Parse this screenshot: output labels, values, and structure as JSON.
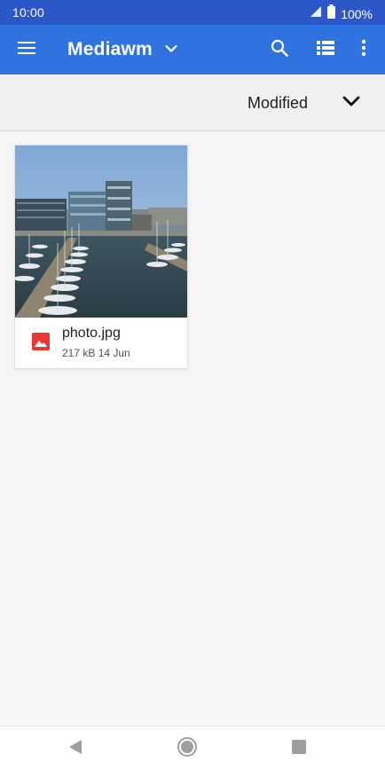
{
  "status_bar": {
    "time": "10:00",
    "battery": "100%",
    "icons": [
      "signal-icon",
      "battery-icon"
    ]
  },
  "app_bar": {
    "title": "Mediawm",
    "icons": [
      "menu-icon",
      "dropdown-arrow-icon",
      "search-icon",
      "list-view-icon",
      "more-vert-icon"
    ],
    "background": "#2f73e0"
  },
  "sort": {
    "label": "Modified",
    "icon": "chevron-down-icon"
  },
  "files": [
    {
      "name": "photo.jpg",
      "size": "217 kB",
      "date": "14 Jun",
      "meta": "217 kB 14 Jun",
      "type_icon": "image-file-icon",
      "type_icon_color": "#e53935"
    }
  ],
  "nav_bar": {
    "icons": [
      "back-icon",
      "home-icon",
      "recents-icon"
    ]
  },
  "colors": {
    "status_bar": "#2b57c9",
    "app_bar": "#2f73e0",
    "background": "#f5f5f5"
  }
}
